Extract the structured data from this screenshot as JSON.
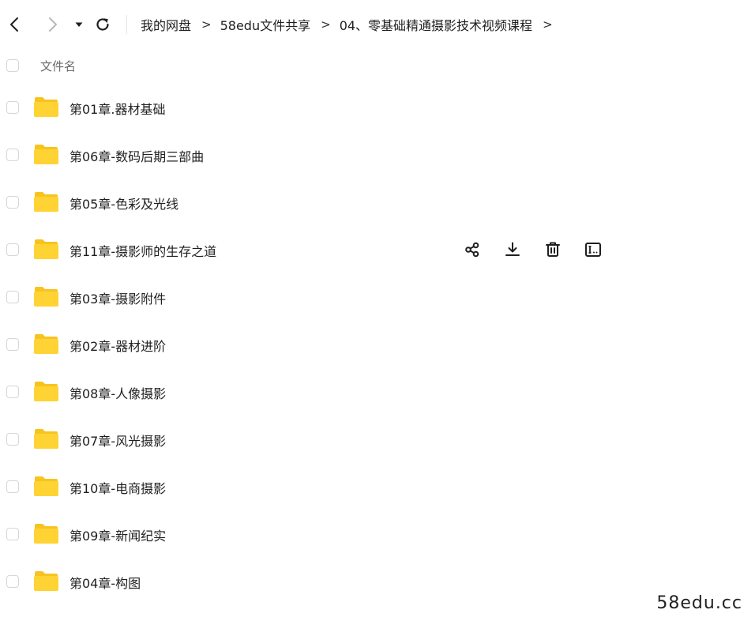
{
  "toolbar": {
    "back_icon": "chevron-left-icon",
    "forward_icon": "chevron-right-icon",
    "history_dropdown_icon": "caret-down-icon",
    "refresh_icon": "refresh-icon"
  },
  "breadcrumb": {
    "items": [
      "我的网盘",
      "58edu文件共享",
      "04、零基础精通摄影技术视频课程"
    ],
    "separator": ">"
  },
  "list_header": {
    "name_column": "文件名"
  },
  "files": [
    {
      "name": "第01章.器材基础"
    },
    {
      "name": "第06章-数码后期三部曲"
    },
    {
      "name": "第05章-色彩及光线"
    },
    {
      "name": "第11章-摄影师的生存之道"
    },
    {
      "name": "第03章-摄影附件"
    },
    {
      "name": "第02章-器材进阶"
    },
    {
      "name": "第08章-人像摄影"
    },
    {
      "name": "第07章-风光摄影"
    },
    {
      "name": "第10章-电商摄影"
    },
    {
      "name": "第09章-新闻纪实"
    },
    {
      "name": "第04章-构图"
    }
  ],
  "hovered_row_actions": {
    "row_index": 3,
    "icons": [
      "share-icon",
      "download-icon",
      "delete-icon",
      "rename-icon"
    ]
  },
  "watermark": "58edu.cc",
  "colors": {
    "folder": "#FFD334",
    "folder_back": "#F8C31F",
    "text": "#1F1F1F",
    "muted_text": "#6B6B6B",
    "checkbox_border": "#D6D6D6"
  }
}
